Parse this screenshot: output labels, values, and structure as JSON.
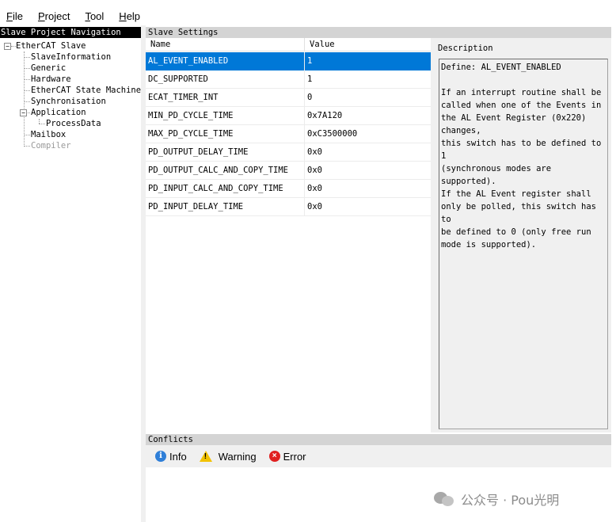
{
  "menu": {
    "items": [
      {
        "underline": "F",
        "rest": "ile"
      },
      {
        "underline": "P",
        "rest": "roject"
      },
      {
        "underline": "T",
        "rest": "ool"
      },
      {
        "underline": "H",
        "rest": "elp"
      }
    ]
  },
  "navigation": {
    "title": "Slave Project Navigation",
    "root": "EtherCAT Slave",
    "items": [
      "SlaveInformation",
      "Generic",
      "Hardware",
      "EtherCAT State Machine",
      "Synchronisation",
      "Application",
      "ProcessData",
      "Mailbox",
      "Compiler"
    ]
  },
  "settings": {
    "title": "Slave Settings",
    "columns": {
      "name": "Name",
      "value": "Value"
    },
    "rows": [
      {
        "name": "AL_EVENT_ENABLED",
        "value": "1"
      },
      {
        "name": "DC_SUPPORTED",
        "value": "1"
      },
      {
        "name": "ECAT_TIMER_INT",
        "value": "0"
      },
      {
        "name": "MIN_PD_CYCLE_TIME",
        "value": "0x7A120"
      },
      {
        "name": "MAX_PD_CYCLE_TIME",
        "value": "0xC3500000"
      },
      {
        "name": "PD_OUTPUT_DELAY_TIME",
        "value": "0x0"
      },
      {
        "name": "PD_OUTPUT_CALC_AND_COPY_TIME",
        "value": "0x0"
      },
      {
        "name": "PD_INPUT_CALC_AND_COPY_TIME",
        "value": "0x0"
      },
      {
        "name": "PD_INPUT_DELAY_TIME",
        "value": "0x0"
      }
    ],
    "description_label": "Description",
    "description_text": "Define: AL_EVENT_ENABLED\n\nIf an interrupt routine shall be\ncalled when one of the Events in\nthe AL Event Register (0x220)\nchanges,\nthis switch has to be defined to 1\n(synchronous modes are supported).\nIf the AL Event register shall\nonly be polled, this switch has to\nbe defined to 0 (only free run\nmode is supported)."
  },
  "conflicts": {
    "title": "Conflicts",
    "tabs": {
      "info": "Info",
      "warning": "Warning",
      "error": "Error"
    }
  },
  "watermark": {
    "text": "公众号 · Pou光明"
  },
  "colors": {
    "selection": "#0078d7",
    "header_bg": "#d4d4d4",
    "panel_bg": "#f0f0f0"
  }
}
